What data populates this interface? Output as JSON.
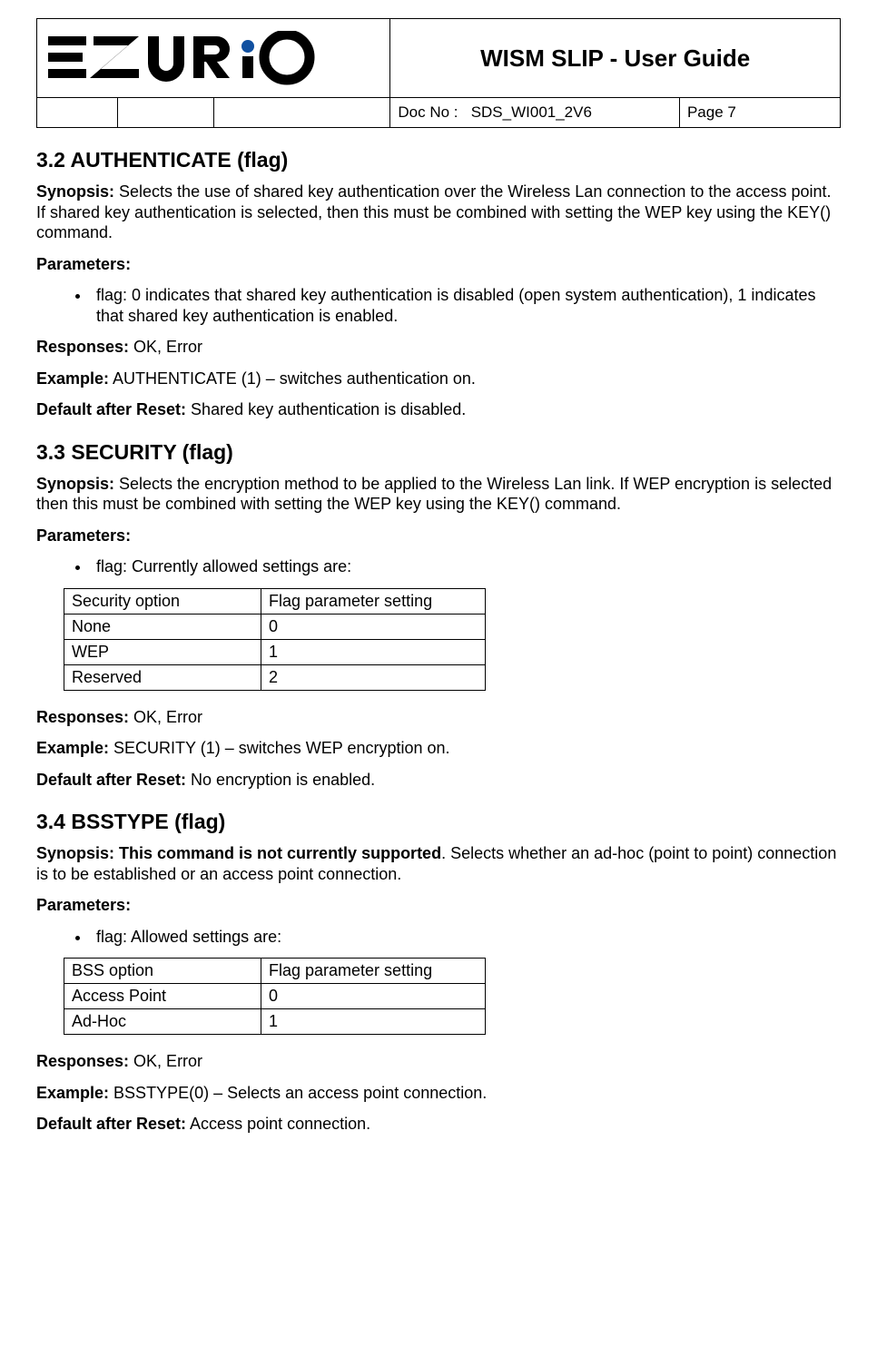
{
  "header": {
    "brand": "EZURiO",
    "title": "WISM SLIP - User Guide",
    "docNoLabel": "Doc No :",
    "docNo": "SDS_WI001_2V6",
    "page": "Page 7"
  },
  "s32": {
    "heading": "3.2  AUTHENTICATE (flag)",
    "labels": {
      "synopsis": "Synopsis:",
      "parameters": "Parameters:",
      "responses": "Responses:",
      "example": "Example:",
      "default": "Default after Reset:"
    },
    "synopsis": " Selects the use of shared key authentication over the Wireless Lan connection to the access point. If shared key authentication is selected, then this must be combined with setting the WEP key using the KEY() command.",
    "bullet": "flag: 0 indicates that shared key authentication is disabled (open system authentication), 1 indicates that shared key authentication is enabled.",
    "responses": " OK, Error",
    "example": " AUTHENTICATE (1) – switches authentication on.",
    "default": " Shared key authentication is disabled."
  },
  "s33": {
    "heading": "3.3  SECURITY (flag)",
    "labels": {
      "synopsis": "Synopsis:",
      "parameters": "Parameters:",
      "responses": "Responses:",
      "example": "Example:",
      "default": "Default after Reset:"
    },
    "synopsis": " Selects the encryption method to be applied to the Wireless Lan link. If WEP encryption is selected then this must be combined with setting the WEP key using the KEY() command.",
    "bullet": "flag: Currently allowed settings are:",
    "table": {
      "h1": "Security option",
      "h2": "Flag parameter setting",
      "r1c1": "None",
      "r1c2": "0",
      "r2c1": "WEP",
      "r2c2": "1",
      "r3c1": "Reserved",
      "r3c2": "2"
    },
    "responses": " OK, Error",
    "example": " SECURITY (1) – switches WEP encryption on.",
    "default": " No encryption is enabled."
  },
  "s34": {
    "heading": "3.4  BSSTYPE (flag)",
    "labels": {
      "synopsisBold": "Synopsis: This command is not currently supported",
      "parameters": "Parameters:",
      "responses": "Responses:",
      "example": "Example:",
      "default": "Default after Reset:"
    },
    "synopsisRest": ". Selects whether an ad-hoc (point to point) connection is to be established or an access point connection.",
    "bullet": "flag: Allowed settings are:",
    "table": {
      "h1": "BSS option",
      "h2": "Flag parameter setting",
      "r1c1": "Access Point",
      "r1c2": "0",
      "r2c1": "Ad-Hoc",
      "r2c2": "1"
    },
    "responses": " OK, Error",
    "example": " BSSTYPE(0) – Selects an access point connection.",
    "default": " Access point connection."
  }
}
